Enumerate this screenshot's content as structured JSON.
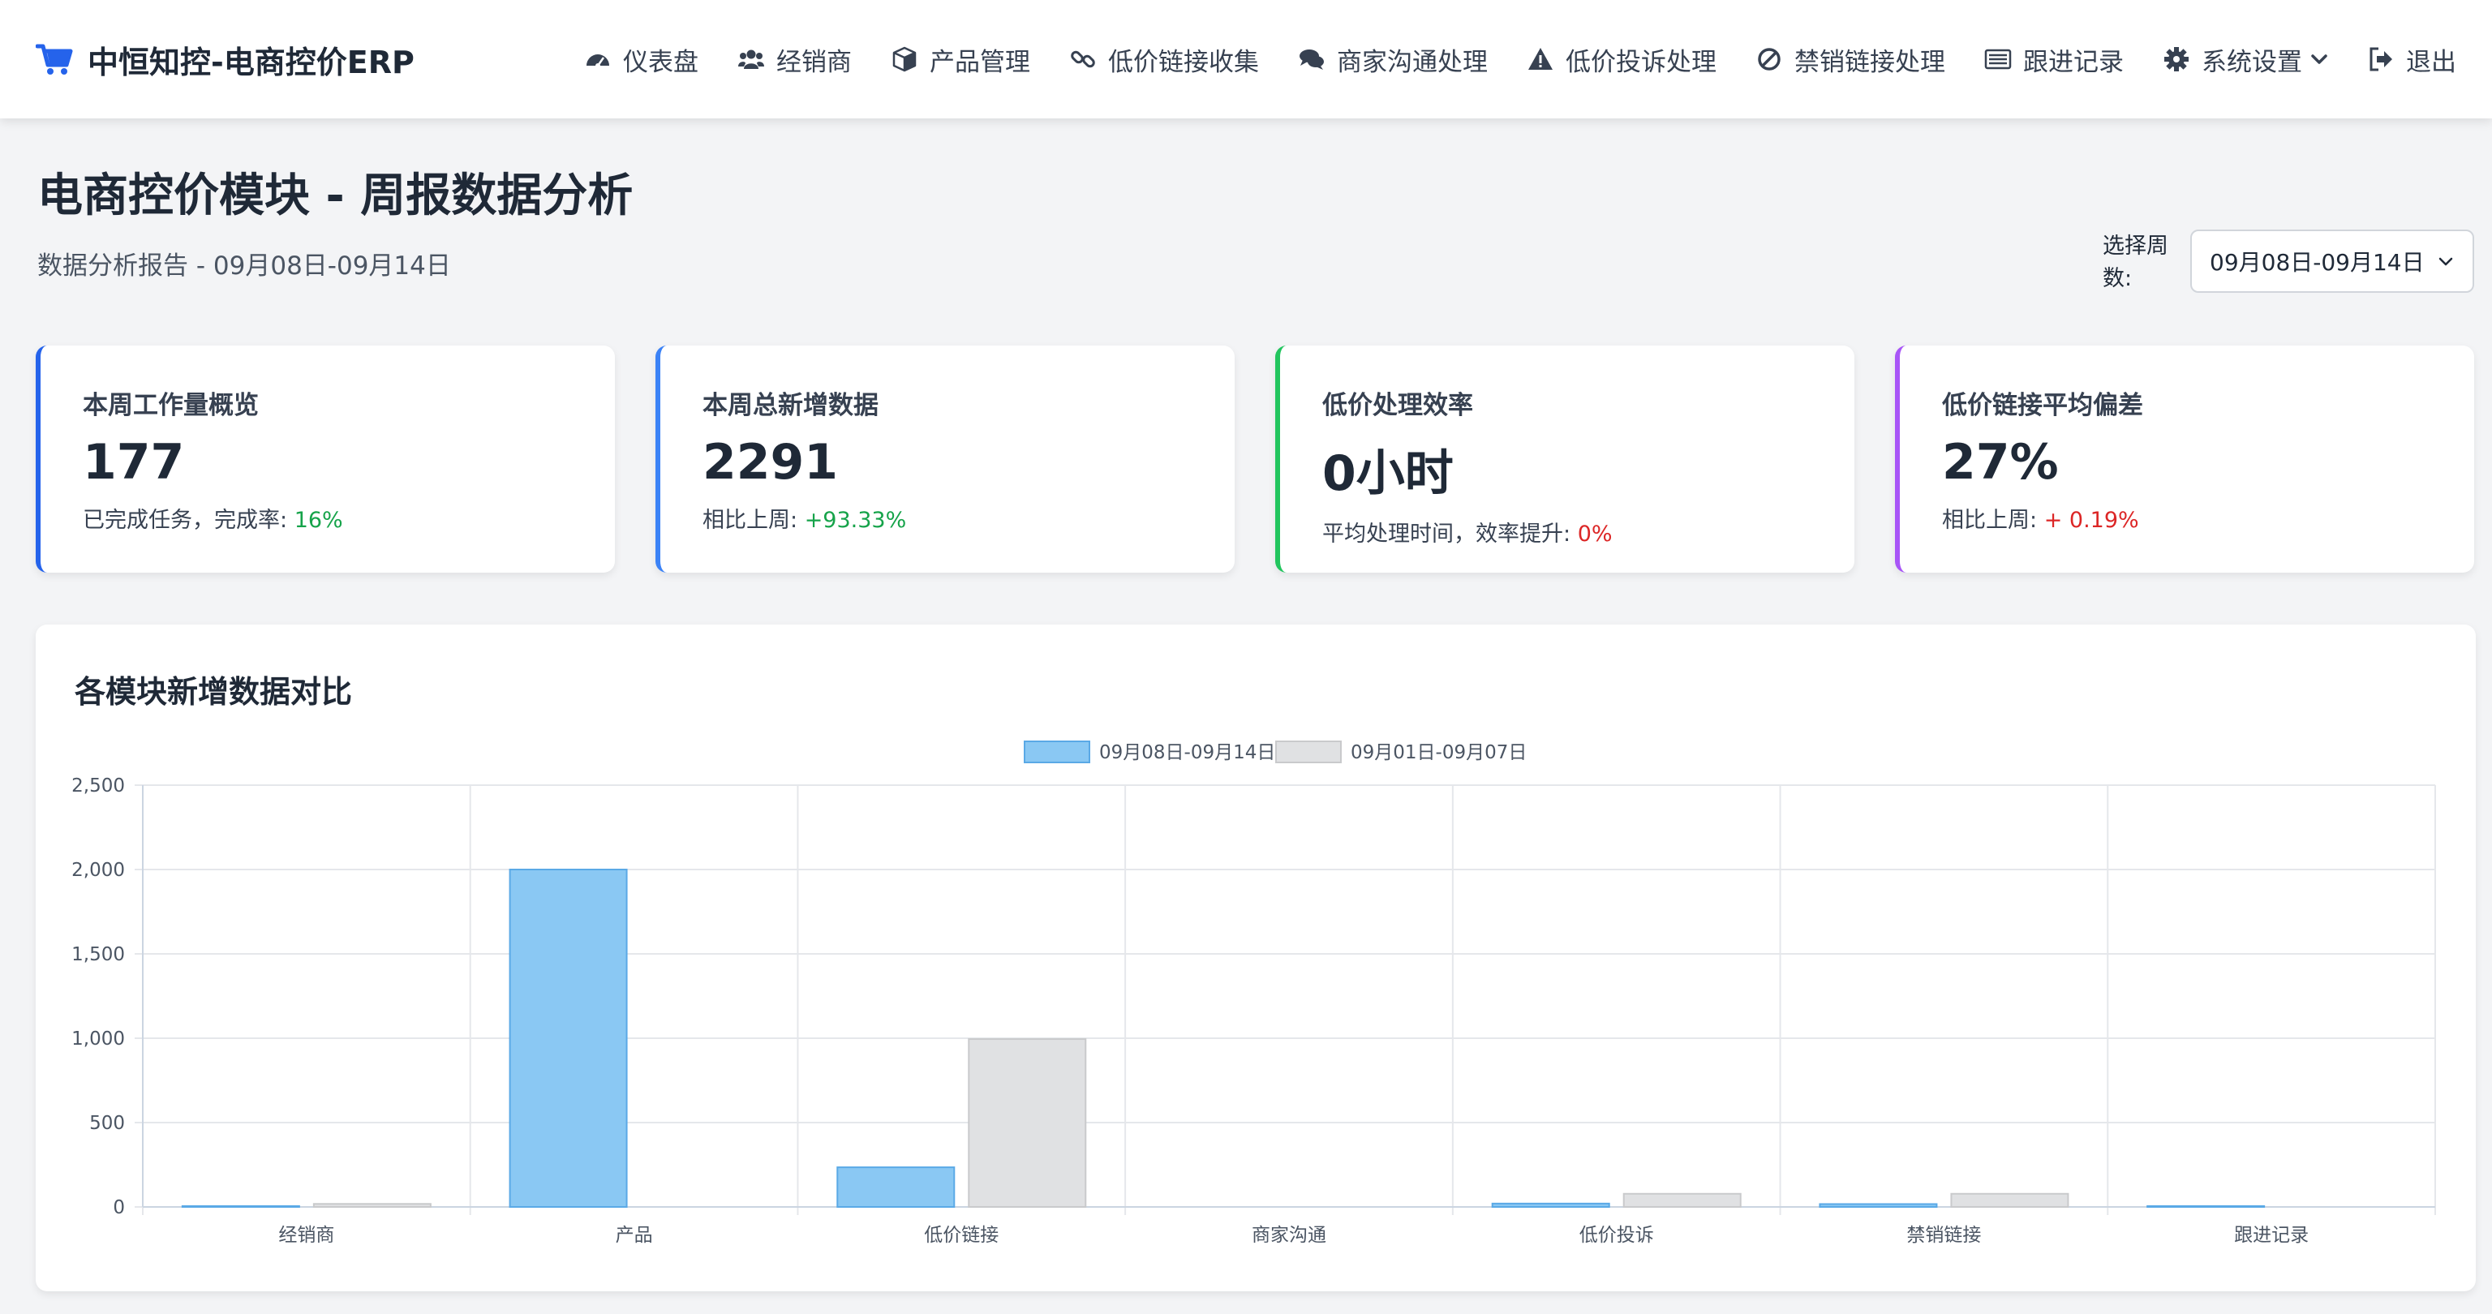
{
  "app": {
    "title": "中恒知控-电商控价ERP",
    "brand_color": "#2563eb"
  },
  "nav": {
    "items": [
      {
        "label": "仪表盘",
        "icon": "dashboard-icon"
      },
      {
        "label": "经销商",
        "icon": "users-icon"
      },
      {
        "label": "产品管理",
        "icon": "box-icon"
      },
      {
        "label": "低价链接收集",
        "icon": "link-icon"
      },
      {
        "label": "商家沟通处理",
        "icon": "chat-icon"
      },
      {
        "label": "低价投诉处理",
        "icon": "warning-icon"
      },
      {
        "label": "禁销链接处理",
        "icon": "ban-icon"
      },
      {
        "label": "跟进记录",
        "icon": "list-icon"
      },
      {
        "label": "系统设置",
        "icon": "gear-icon"
      },
      {
        "label": "退出",
        "icon": "logout-icon"
      }
    ]
  },
  "header": {
    "title": "电商控价模块 - 周报数据分析",
    "subtitle": "数据分析报告 - 09月08日-09月14日",
    "week_label": "选择周数:",
    "week_selected": "09月08日-09月14日"
  },
  "cards": [
    {
      "label": "本周工作量概览",
      "value": "177",
      "sub_text": "已完成任务，完成率: ",
      "sub_value": "16%",
      "tone": "pos",
      "accent": "#2563eb"
    },
    {
      "label": "本周总新增数据",
      "value": "2291",
      "sub_text": "相比上周: ",
      "sub_value": "+93.33%",
      "tone": "pos",
      "accent": "#3b82f6"
    },
    {
      "label": "低价处理效率",
      "value": "0小时",
      "sub_text": "平均处理时间，效率提升: ",
      "sub_value": "0%",
      "tone": "neg",
      "accent": "#22c55e"
    },
    {
      "label": "低价链接平均偏差",
      "value": "27%",
      "sub_text": "相比上周: ",
      "sub_value": "+ 0.19%",
      "tone": "neg",
      "accent": "#a855f7"
    }
  ],
  "chart": {
    "title": "各模块新增数据对比"
  },
  "chart_data": {
    "type": "bar",
    "categories": [
      "经销商",
      "产品",
      "低价链接",
      "商家沟通",
      "低价投诉",
      "禁销链接",
      "跟进记录"
    ],
    "series": [
      {
        "name": "09月08日-09月14日",
        "values": [
          5,
          2000,
          235,
          0,
          20,
          17,
          5
        ],
        "color": "#8ac8f3",
        "stroke": "#5aa9e6"
      },
      {
        "name": "09月01日-09月07日",
        "values": [
          18,
          0,
          995,
          0,
          78,
          78,
          0
        ],
        "color": "#e0e1e3",
        "stroke": "#c9cacc"
      }
    ],
    "ylim": [
      0,
      2500
    ],
    "yticks": [
      0,
      500,
      1000,
      1500,
      2000,
      2500
    ],
    "ytick_labels": [
      "0",
      "500",
      "1,000",
      "1,500",
      "2,000",
      "2,500"
    ],
    "grid": true,
    "legend": "top-center"
  }
}
